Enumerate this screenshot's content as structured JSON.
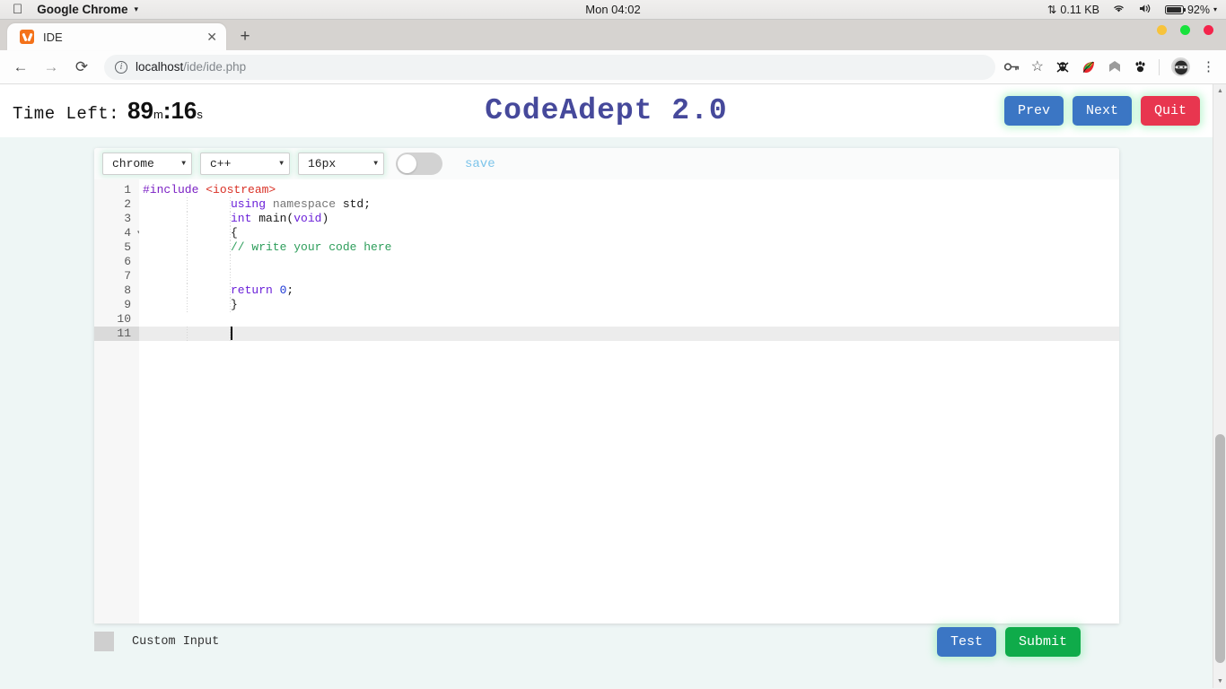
{
  "os_bar": {
    "apple_icon": "apple-logo",
    "app_name": "Google Chrome",
    "menu_caret": "▾",
    "clock": "Mon 04:02",
    "network_icon": "⇅",
    "network_value": "0.11 KB",
    "wifi_icon": "wifi-icon",
    "volume_icon": "🔊",
    "battery_icon": "battery-icon",
    "battery_value": "92%",
    "battery_caret": "▾"
  },
  "browser": {
    "tab": {
      "title": "IDE",
      "favicon": "xampp-icon",
      "close": "✕"
    },
    "new_tab": "+",
    "window_buttons": [
      "#f7c33b",
      "#18e23c",
      "#f4244b"
    ],
    "nav": {
      "back": "←",
      "forward": "→",
      "reload": "⟳"
    },
    "omnibox": {
      "site_info_icon": "info-icon",
      "url_host": "localhost",
      "url_path": "/ide/ide.php"
    },
    "extensions": [
      {
        "name": "password-key-icon",
        "glyph": "⚷"
      },
      {
        "name": "bookmark-star-icon",
        "glyph": "☆"
      },
      {
        "name": "pirate-skull-icon",
        "glyph": "☠"
      },
      {
        "name": "colorful-leaf-icon",
        "glyph": "🌶"
      },
      {
        "name": "gray-arrow-icon",
        "glyph": "⌂"
      },
      {
        "name": "paw-icon",
        "glyph": "🐾"
      }
    ],
    "profile_avatar": "ninja-avatar",
    "menu_kebab": "⋮"
  },
  "app": {
    "timer": {
      "label": "Time Left:",
      "minutes": "89",
      "minutes_unit": "m",
      "separator": ":",
      "seconds": "16",
      "seconds_unit": "s"
    },
    "title": "CodeAdept 2.0",
    "header_buttons": [
      {
        "label": "Prev",
        "name": "prev-button",
        "color": "#3b76c4"
      },
      {
        "label": "Next",
        "name": "next-button",
        "color": "#3b76c4"
      },
      {
        "label": "Quit",
        "name": "quit-button",
        "color": "#e8364f"
      }
    ]
  },
  "editor": {
    "toolbar": {
      "theme_select": {
        "value": "chrome",
        "arrow": "▼"
      },
      "language_select": {
        "value": "c++",
        "arrow": "▼"
      },
      "fontsize_select": {
        "value": "16px",
        "arrow": "▼"
      },
      "autosave_toggle": "off",
      "save_label": "save"
    },
    "line_numbers": [
      "1",
      "2",
      "3",
      "4",
      "5",
      "6",
      "7",
      "8",
      "9",
      "10",
      "11"
    ],
    "fold_marker": "▾",
    "fold_line": "4",
    "active_line": "11",
    "lines": [
      {
        "n": "1",
        "indent": false,
        "tokens": [
          {
            "t": "#include ",
            "c": "tk-pre"
          },
          {
            "t": "<iostream>",
            "c": "tk-inc"
          }
        ]
      },
      {
        "n": "2",
        "indent": true,
        "tokens": [
          {
            "t": "using ",
            "c": "tk-kw"
          },
          {
            "t": "namespace ",
            "c": "tk-ns"
          },
          {
            "t": "std;",
            "c": "tk-plain"
          }
        ]
      },
      {
        "n": "3",
        "indent": true,
        "tokens": [
          {
            "t": "int ",
            "c": "tk-kw"
          },
          {
            "t": "main(",
            "c": "tk-plain"
          },
          {
            "t": "void",
            "c": "tk-kw"
          },
          {
            "t": ")",
            "c": "tk-plain"
          }
        ]
      },
      {
        "n": "4",
        "indent": true,
        "tokens": [
          {
            "t": "{",
            "c": "tk-plain"
          }
        ]
      },
      {
        "n": "5",
        "indent": true,
        "tokens": [
          {
            "t": "// write your code here",
            "c": "tk-com"
          }
        ]
      },
      {
        "n": "6",
        "indent": true,
        "tokens": []
      },
      {
        "n": "7",
        "indent": true,
        "tokens": []
      },
      {
        "n": "8",
        "indent": true,
        "tokens": [
          {
            "t": "return ",
            "c": "tk-kw"
          },
          {
            "t": "0",
            "c": "tk-num"
          },
          {
            "t": ";",
            "c": "tk-plain"
          }
        ]
      },
      {
        "n": "9",
        "indent": true,
        "tokens": [
          {
            "t": "}",
            "c": "tk-plain"
          }
        ]
      },
      {
        "n": "10",
        "indent": false,
        "tokens": []
      },
      {
        "n": "11",
        "indent": true,
        "tokens": [],
        "cursor": true
      }
    ]
  },
  "footer": {
    "custom_input_label": "Custom Input",
    "custom_input_checked": false,
    "buttons": [
      {
        "label": "Test",
        "name": "test-button",
        "color": "#3b76c4"
      },
      {
        "label": "Submit",
        "name": "submit-button",
        "color": "#0fab4a"
      }
    ]
  }
}
